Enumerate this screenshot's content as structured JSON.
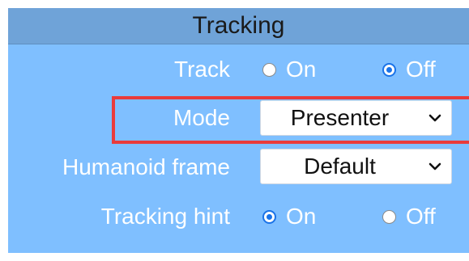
{
  "panel": {
    "title": "Tracking"
  },
  "track": {
    "label": "Track",
    "options": [
      {
        "label": "On",
        "checked": false
      },
      {
        "label": "Off",
        "checked": true
      }
    ]
  },
  "mode": {
    "label": "Mode",
    "selected": "Presenter"
  },
  "humanoid_frame": {
    "label": "Humanoid frame",
    "selected": "Default"
  },
  "tracking_hint": {
    "label": "Tracking hint",
    "options": [
      {
        "label": "On",
        "checked": true
      },
      {
        "label": "Off",
        "checked": false
      }
    ]
  },
  "colors": {
    "panel_bg": "#7fbfff",
    "header_bg": "#6fa3d8",
    "highlight": "#ea3b3b",
    "radio_accent": "#1a73e8"
  },
  "icons": {
    "select_arrow": "chevron-down-icon",
    "radio": "radio-button-icon"
  }
}
